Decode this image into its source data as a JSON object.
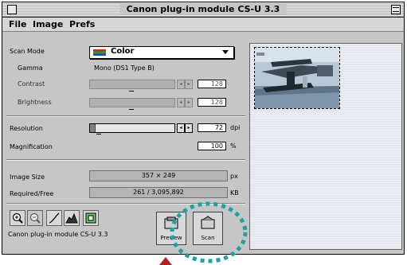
{
  "window": {
    "title": "Canon plug-in module CS-U 3.3"
  },
  "menu": {
    "file": "File",
    "image": "Image",
    "prefs": "Prefs"
  },
  "scan_mode": {
    "label": "Scan Mode",
    "value": "Color"
  },
  "gamma": {
    "label": "Gamma",
    "value": "Mono (DS1 Type B)"
  },
  "contrast": {
    "label": "Contrast",
    "value": "128"
  },
  "brightness": {
    "label": "Brightness",
    "value": "128"
  },
  "resolution": {
    "label": "Resolution",
    "value": "72",
    "unit": "dpi"
  },
  "magnification": {
    "label": "Magnification",
    "value": "100",
    "unit": "%"
  },
  "image_size": {
    "label": "Image Size",
    "value": "357 × 249",
    "unit": "px"
  },
  "required_free": {
    "label": "Required/Free",
    "value": "261 / 3,095,892",
    "unit": "KB"
  },
  "buttons": {
    "preview": "Preview",
    "scan": "Scan"
  },
  "status": "Canon plug-in module CS-U 3.3",
  "colors": {
    "highlight_ring": "#1aa3a3",
    "cursor_arrow": "#b02020"
  }
}
